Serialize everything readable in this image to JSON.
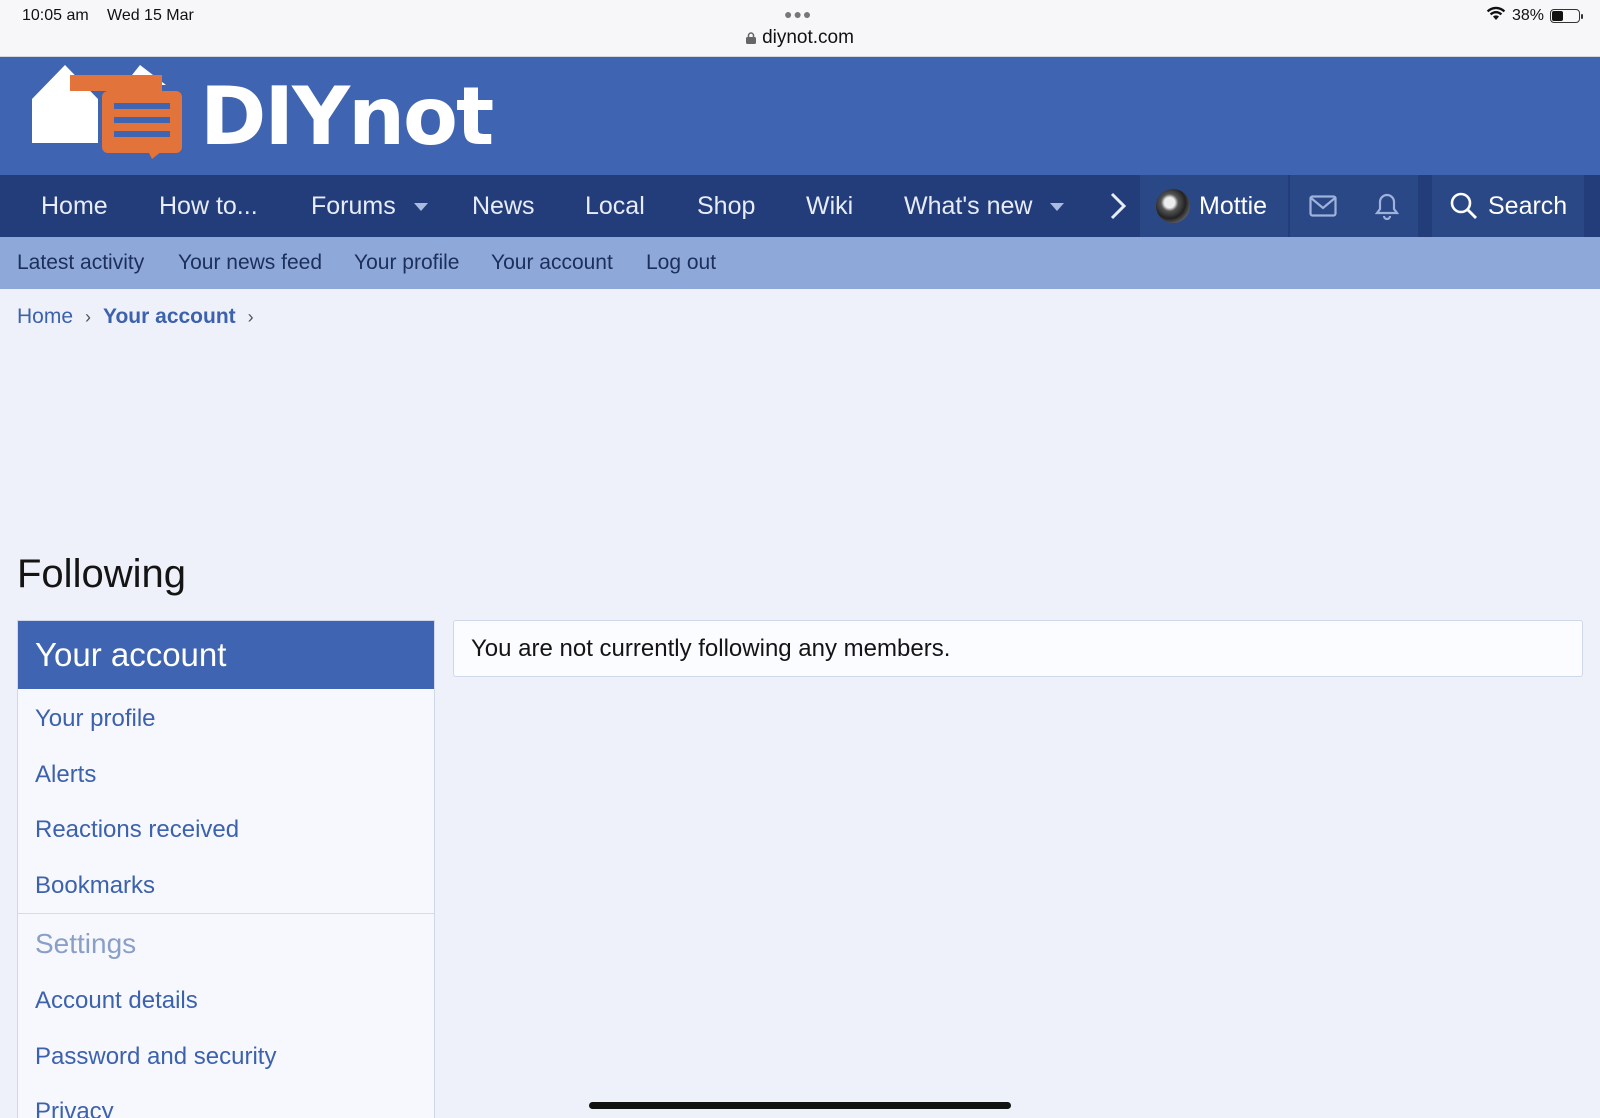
{
  "status_bar": {
    "time": "10:05 am",
    "date": "Wed 15 Mar",
    "url": "diynot.com",
    "battery": "38%",
    "battery_level": 0.38
  },
  "brand": {
    "name": "DIYnot",
    "colors": {
      "header": "#3f64b1",
      "nav": "#233d7a",
      "subnav": "#8ea8da",
      "accent_orange": "#e2733a"
    }
  },
  "nav": {
    "items": [
      {
        "label": "Home"
      },
      {
        "label": "How to..."
      },
      {
        "label": "Forums",
        "dropdown": true
      },
      {
        "label": "News"
      },
      {
        "label": "Local"
      },
      {
        "label": "Shop"
      },
      {
        "label": "Wiki"
      },
      {
        "label": "What's new",
        "dropdown": true
      }
    ],
    "user": "Mottie",
    "search_label": "Search",
    "icons": [
      "chevron-right-icon",
      "envelope-icon",
      "bell-icon",
      "search-icon"
    ]
  },
  "subnav": {
    "items": [
      {
        "label": "Latest activity"
      },
      {
        "label": "Your news feed"
      },
      {
        "label": "Your profile"
      },
      {
        "label": "Your account"
      },
      {
        "label": "Log out"
      }
    ]
  },
  "breadcrumb": {
    "home": "Home",
    "current": "Your account"
  },
  "page": {
    "title": "Following",
    "message": "You are not currently following any members."
  },
  "sidebar": {
    "title": "Your account",
    "items": [
      {
        "label": "Your profile"
      },
      {
        "label": "Alerts"
      },
      {
        "label": "Reactions received"
      },
      {
        "label": "Bookmarks"
      }
    ],
    "settings_heading": "Settings",
    "settings_items": [
      {
        "label": "Account details"
      },
      {
        "label": "Password and security"
      },
      {
        "label": "Privacy"
      }
    ]
  }
}
